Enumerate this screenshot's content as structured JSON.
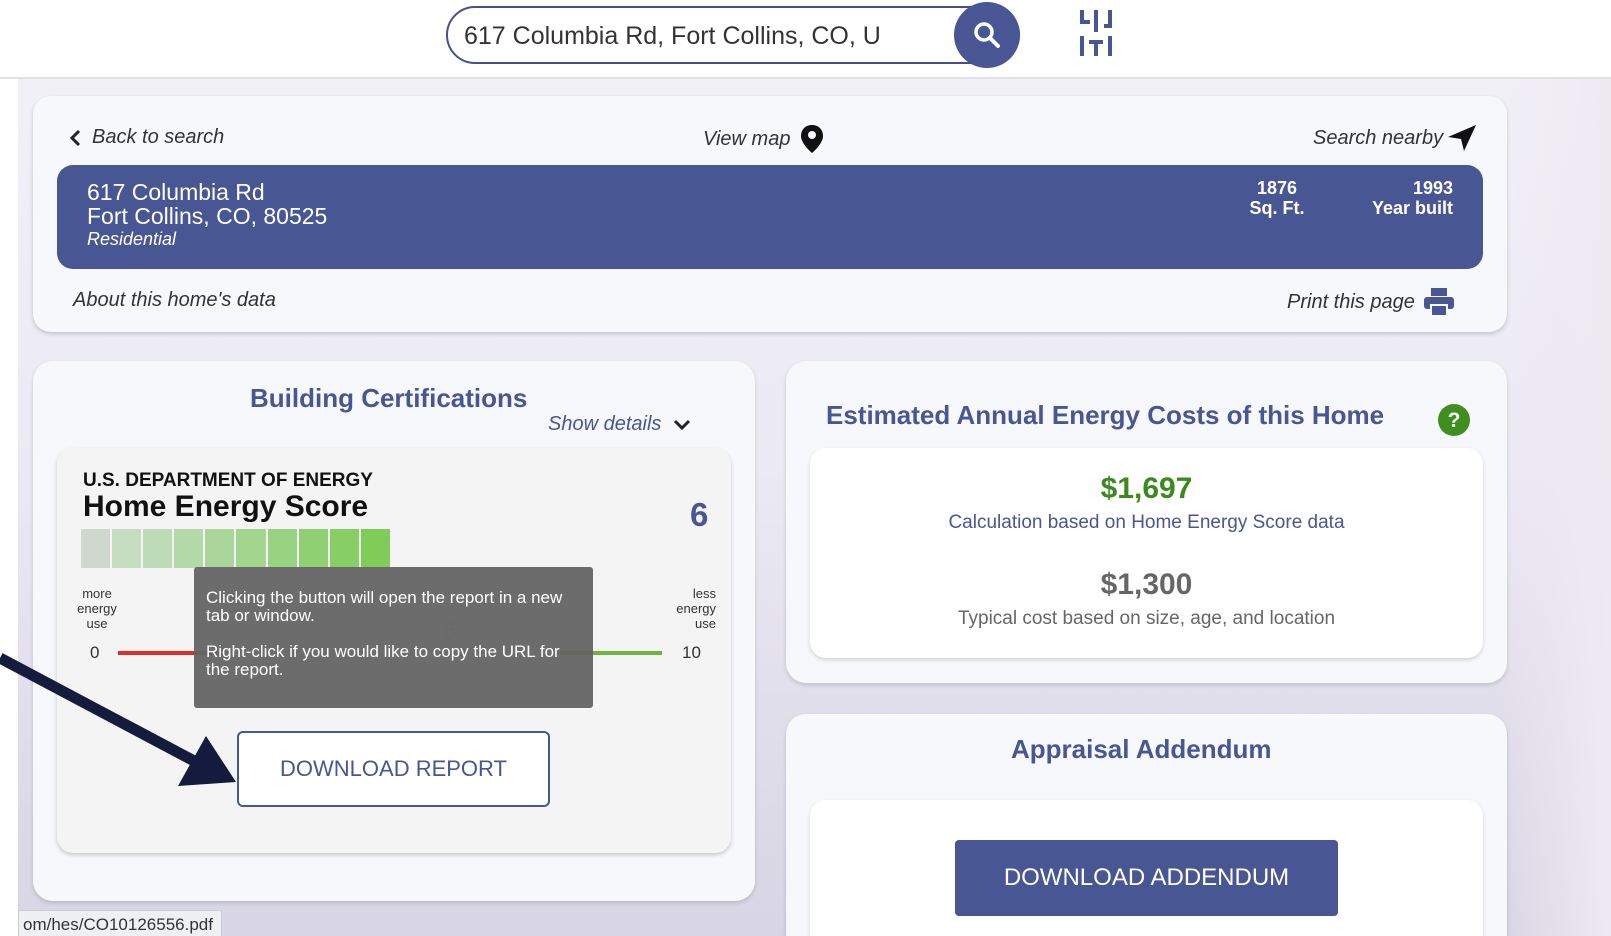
{
  "search": {
    "value": "617 Columbia Rd, Fort Collins, CO, U",
    "search_icon": "search-icon",
    "filter_icon": "sliders-icon"
  },
  "nav": {
    "back_label": "Back to search",
    "view_map_label": "View map",
    "search_nearby_label": "Search nearby"
  },
  "property": {
    "street": "617 Columbia Rd",
    "city_line": "Fort Collins, CO, 80525",
    "type": "Residential",
    "sqft_value": "1876",
    "sqft_label": "Sq. Ft.",
    "year_value": "1993",
    "year_label": "Year built"
  },
  "footer_links": {
    "about": "About this home's data",
    "print": "Print this page"
  },
  "certifications": {
    "title": "Building Certifications",
    "show_details": "Show details",
    "agency": "U.S. DEPARTMENT OF ENERGY",
    "program": "Home Energy Score",
    "score": "6",
    "score_level": 10,
    "scale_min": "0",
    "scale_max": "10",
    "more_label": "more energy use",
    "less_label": "less energy use",
    "segment_colors": [
      "#cfd8ce",
      "#c5dcc0",
      "#bddbb6",
      "#b4d9a9",
      "#aad69c",
      "#a2d68f",
      "#98d381",
      "#8fd072",
      "#87cf65",
      "#80cc58"
    ],
    "tooltip_line1": "Clicking the button will open the report in a new tab or window.",
    "tooltip_line2": "Right-click if you would like to copy the URL for the report.",
    "download_label": "DOWNLOAD REPORT"
  },
  "costs": {
    "title": "Estimated Annual Energy Costs of this Home",
    "hes_value": "$1,697",
    "hes_desc": "Calculation based on Home Energy Score data",
    "typical_value": "$1,300",
    "typical_desc": "Typical cost based on size, age, and location"
  },
  "appraisal": {
    "title": "Appraisal Addendum",
    "download_label": "DOWNLOAD ADDENDUM"
  },
  "status_bar": {
    "url": "om/hes/CO10126556.pdf"
  },
  "colors": {
    "brand": "#485693",
    "cost_green": "#3b8a20",
    "help_green": "#3f8f1f",
    "line_red": "#e22b2b",
    "line_green": "#6fb541"
  }
}
